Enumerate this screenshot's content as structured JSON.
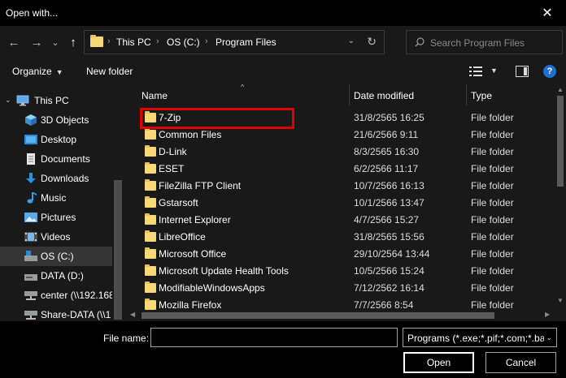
{
  "window": {
    "title": "Open with...",
    "close_glyph": "✕"
  },
  "nav": {
    "back_glyph": "←",
    "forward_glyph": "→",
    "recent_glyph": "⌄",
    "up_glyph": "↑"
  },
  "address": {
    "crumbs": [
      "This PC",
      "OS (C:)",
      "Program Files"
    ],
    "separator": "›",
    "dropdown_glyph": "⌄",
    "refresh_glyph": "↻"
  },
  "search": {
    "placeholder": "Search Program Files"
  },
  "toolbar": {
    "organize_label": "Organize",
    "organize_caret": "▼",
    "new_folder_label": "New folder",
    "view_caret": "▼",
    "help_label": "?"
  },
  "sidebar": {
    "expand_glyph": "⌄",
    "items": [
      {
        "label": "This PC",
        "icon": "computer-icon"
      },
      {
        "label": "3D Objects",
        "icon": "cube-icon"
      },
      {
        "label": "Desktop",
        "icon": "desktop-icon"
      },
      {
        "label": "Documents",
        "icon": "document-icon"
      },
      {
        "label": "Downloads",
        "icon": "download-icon"
      },
      {
        "label": "Music",
        "icon": "music-icon"
      },
      {
        "label": "Pictures",
        "icon": "picture-icon"
      },
      {
        "label": "Videos",
        "icon": "video-icon"
      },
      {
        "label": "OS (C:)",
        "icon": "drive-icon"
      },
      {
        "label": "DATA (D:)",
        "icon": "drive-icon"
      },
      {
        "label": "center (\\\\192.168",
        "icon": "network-drive-icon"
      },
      {
        "label": "Share-DATA (\\\\1",
        "icon": "network-drive-icon"
      }
    ]
  },
  "columns": {
    "name": "Name",
    "date": "Date modified",
    "type": "Type",
    "sort_glyph": "^"
  },
  "files": [
    {
      "name": "7-Zip",
      "date": "31/8/2565 16:25",
      "type": "File folder"
    },
    {
      "name": "Common Files",
      "date": "21/6/2566 9:11",
      "type": "File folder"
    },
    {
      "name": "D-Link",
      "date": "8/3/2565 16:30",
      "type": "File folder"
    },
    {
      "name": "ESET",
      "date": "6/2/2566 11:17",
      "type": "File folder"
    },
    {
      "name": "FileZilla FTP Client",
      "date": "10/7/2566 16:13",
      "type": "File folder"
    },
    {
      "name": "Gstarsoft",
      "date": "10/1/2566 13:47",
      "type": "File folder"
    },
    {
      "name": "Internet Explorer",
      "date": "4/7/2566 15:27",
      "type": "File folder"
    },
    {
      "name": "LibreOffice",
      "date": "31/8/2565 15:56",
      "type": "File folder"
    },
    {
      "name": "Microsoft Office",
      "date": "29/10/2564 13:44",
      "type": "File folder"
    },
    {
      "name": "Microsoft Update Health Tools",
      "date": "10/5/2566 15:24",
      "type": "File folder"
    },
    {
      "name": "ModifiableWindowsApps",
      "date": "7/12/2562 16:14",
      "type": "File folder"
    },
    {
      "name": "Mozilla Firefox",
      "date": "7/7/2566 8:54",
      "type": "File folder"
    }
  ],
  "scroll": {
    "up_glyph": "▲",
    "down_glyph": "▼",
    "left_glyph": "◀",
    "right_glyph": "▶"
  },
  "bottom": {
    "file_name_label": "File name:",
    "file_name_value": "",
    "filter_value": "Programs (*.exe;*.pif;*.com;*.bat;*.cmd)",
    "filter_caret": "⌄",
    "open_label": "Open",
    "cancel_label": "Cancel"
  }
}
